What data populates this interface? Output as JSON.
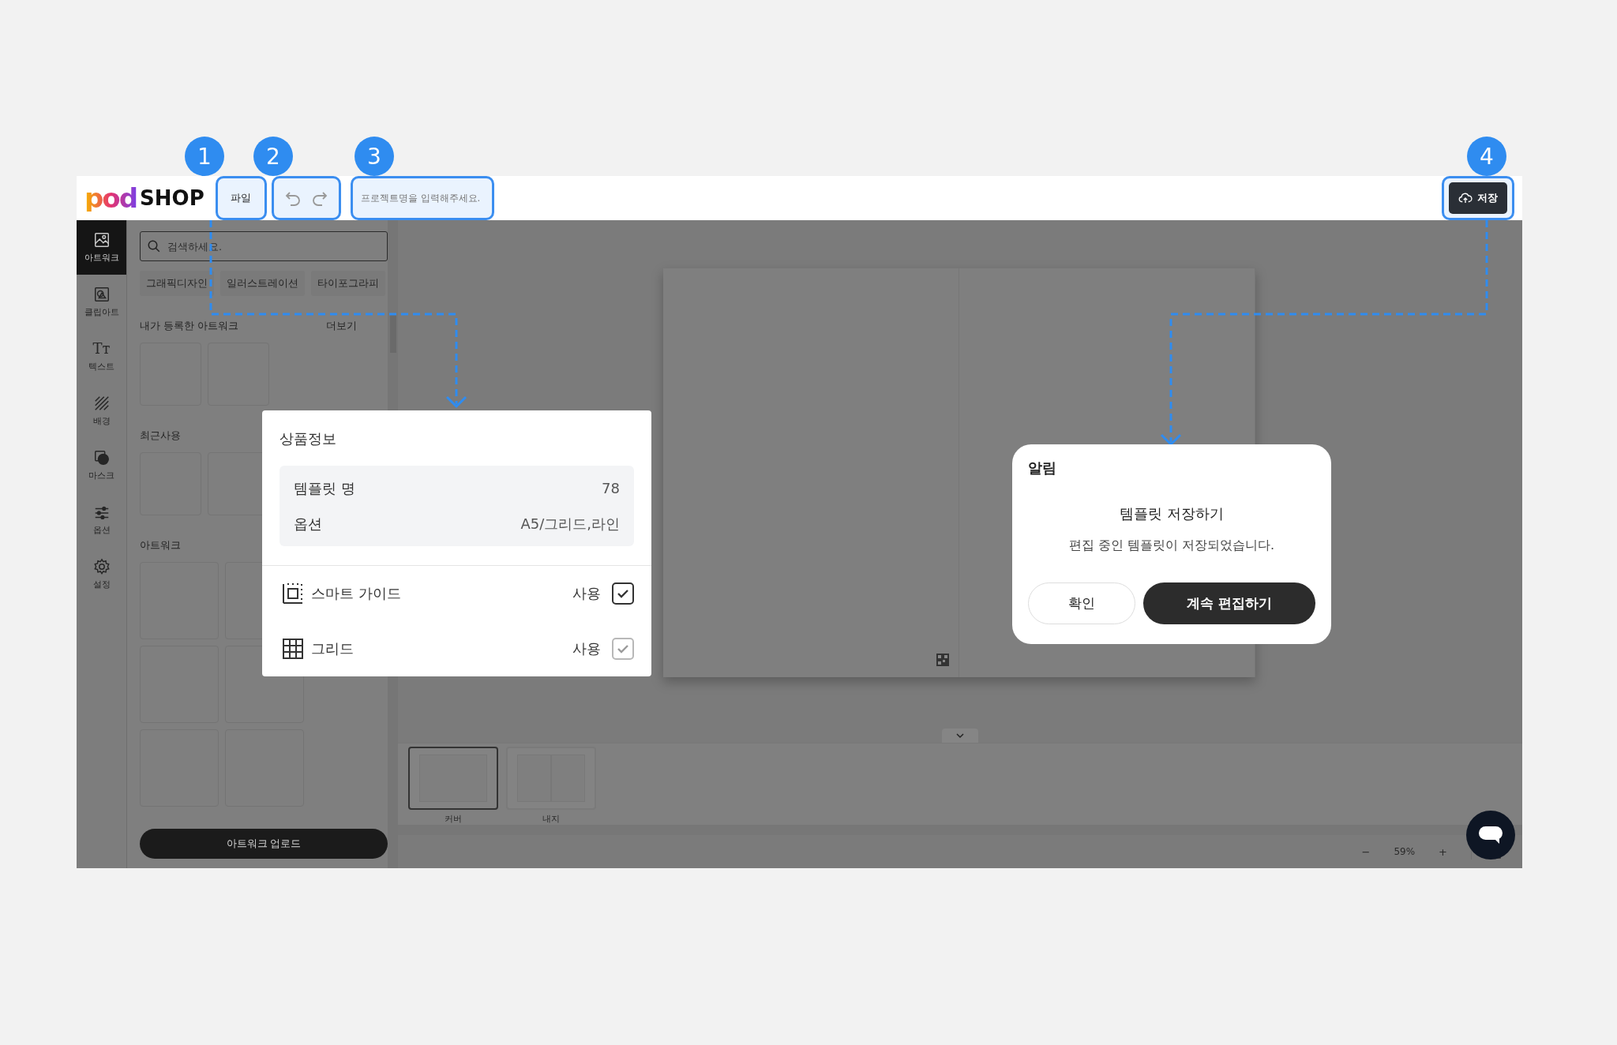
{
  "header": {
    "logo_mark": "pod",
    "logo_text": "SHOP",
    "file_menu": "파일",
    "project_name": {
      "placeholder": "프로젝트명을 입력해주세요."
    },
    "save_button": "저장"
  },
  "callouts": [
    "1",
    "2",
    "3",
    "4"
  ],
  "rail": [
    {
      "label": "아트워크",
      "selected": true
    },
    {
      "label": "클립아트",
      "selected": false
    },
    {
      "label": "텍스트",
      "selected": false,
      "glyph": "Tт"
    },
    {
      "label": "배경",
      "selected": false
    },
    {
      "label": "마스크",
      "selected": false
    },
    {
      "label": "옵션",
      "selected": false
    },
    {
      "label": "설정",
      "selected": false
    }
  ],
  "panel": {
    "search": {
      "placeholder": "검색하세요."
    },
    "categories": [
      "그래픽디자인",
      "일러스트레이션",
      "타이포그라피"
    ],
    "sections": [
      {
        "title": "내가 등록한 아트워크",
        "more": "더보기"
      },
      {
        "title": "최근사용"
      },
      {
        "title": "아트워크"
      }
    ],
    "upload_button": "아트워크 업로드"
  },
  "pages": [
    {
      "label": "커버",
      "selected": true
    },
    {
      "label": "내지",
      "selected": false
    }
  ],
  "zoom": {
    "minus": "−",
    "value": "59%",
    "plus": "+"
  },
  "product_info": {
    "title": "상품정보",
    "rows": [
      {
        "label": "템플릿 명",
        "value": "78"
      },
      {
        "label": "옵션",
        "value": "A5/그리드,라인"
      }
    ],
    "settings": [
      {
        "label": "스마트 가이드",
        "status": "사용",
        "checked": true,
        "disabled": false
      },
      {
        "label": "그리드",
        "status": "사용",
        "checked": true,
        "disabled": true
      }
    ]
  },
  "alert": {
    "title": "알림",
    "heading": "템플릿 저장하기",
    "message": "편집 중인 템플릿이 저장되었습니다.",
    "buttons": [
      {
        "label": "확인",
        "primary": false
      },
      {
        "label": "계속 편집하기",
        "primary": true
      }
    ]
  }
}
